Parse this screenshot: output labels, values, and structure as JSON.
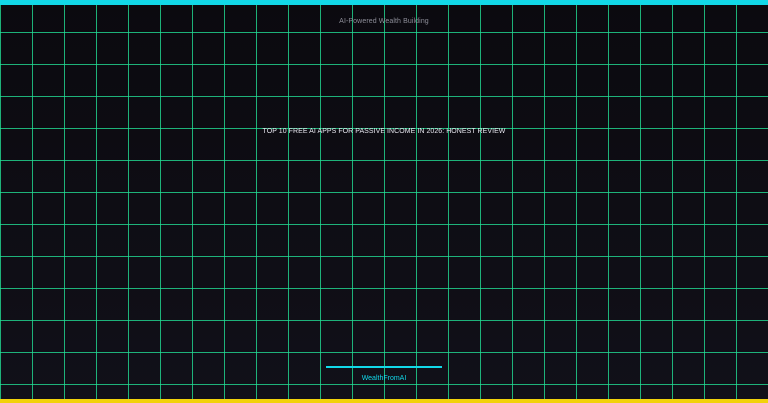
{
  "card": {
    "category": "AI-Powered Wealth Building",
    "headline": "TOP 10 FREE AI APPS FOR PASSIVE INCOME IN 2026: HONEST REVIEW",
    "brand": "WealthFromAI"
  },
  "colors": {
    "background": "#0c0b10",
    "grid_lines": "#22e096",
    "top_accent": "#12d8e8",
    "bottom_accent": "#f2d20b",
    "brand": "#12d8e8"
  }
}
